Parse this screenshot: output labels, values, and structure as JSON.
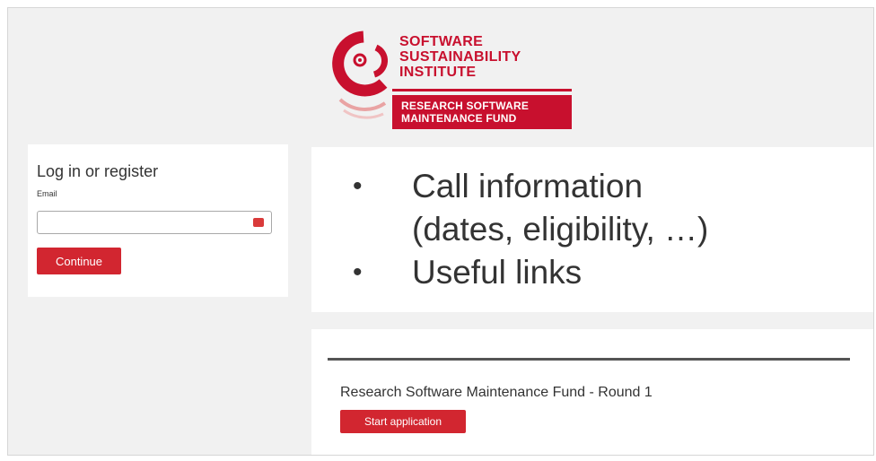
{
  "logo": {
    "lines": [
      "SOFTWARE",
      "SUSTAINABILITY",
      "INSTITUTE"
    ],
    "fund_lines": [
      "RESEARCH SOFTWARE",
      "MAINTENANCE FUND"
    ],
    "brand_color": "#c8102e"
  },
  "login": {
    "title": "Log in or register",
    "email_label": "Email",
    "email_value": "",
    "email_placeholder": "",
    "field_icon": "password-manager-icon",
    "continue_label": "Continue"
  },
  "info": {
    "items": [
      "Call information",
      "(dates, eligibility, …)",
      "Useful links"
    ]
  },
  "round": {
    "title": "Research Software Maintenance Fund - Round 1",
    "start_label": "Start application"
  },
  "colors": {
    "button": "#d22630",
    "background": "#f1f1f1"
  }
}
